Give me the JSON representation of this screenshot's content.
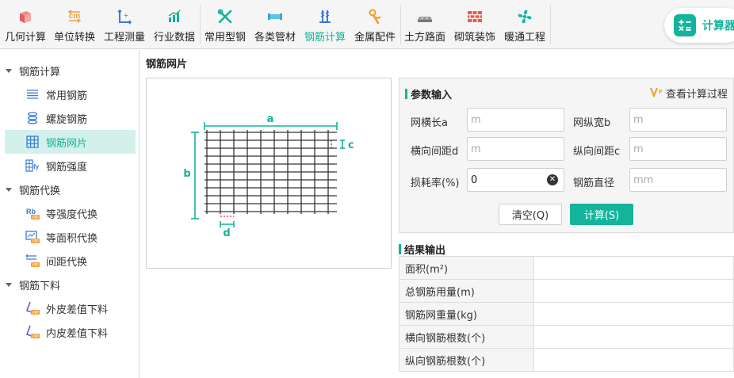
{
  "toolbar": {
    "items": [
      {
        "label": "几何计算",
        "icon": "cube-icon",
        "active": false
      },
      {
        "label": "单位转换",
        "icon": "unit-convert-icon",
        "active": false
      },
      {
        "label": "工程测量",
        "icon": "measure-axis-icon",
        "active": false
      },
      {
        "label": "行业数据",
        "icon": "bar-chart-icon",
        "active": false
      },
      {
        "label": "常用型钢",
        "icon": "wrench-icon",
        "active": false
      },
      {
        "label": "各类管材",
        "icon": "pipe-icon",
        "active": false
      },
      {
        "label": "钢筋计算",
        "icon": "rebar-icon",
        "active": true
      },
      {
        "label": "金属配件",
        "icon": "metal-fitting-icon",
        "active": false
      },
      {
        "label": "土方路面",
        "icon": "road-icon",
        "active": false
      },
      {
        "label": "砌筑装饰",
        "icon": "brick-wall-icon",
        "active": false
      },
      {
        "label": "暖通工程",
        "icon": "fan-icon",
        "active": false
      }
    ],
    "calculator_label": "计算器"
  },
  "sidebar": {
    "groups": [
      {
        "label": "钢筋计算",
        "items": [
          {
            "label": "常用钢筋",
            "icon": "lines-icon",
            "active": false
          },
          {
            "label": "螺旋钢筋",
            "icon": "spiral-icon",
            "active": false
          },
          {
            "label": "钢筋网片",
            "icon": "grid-icon",
            "active": true
          },
          {
            "label": "钢筋强度",
            "icon": "strength-fy-icon",
            "active": false
          }
        ]
      },
      {
        "label": "钢筋代换",
        "items": [
          {
            "label": "等强度代换",
            "icon": "rb-vip-icon",
            "active": false
          },
          {
            "label": "等面积代换",
            "icon": "area-vip-icon",
            "active": false
          },
          {
            "label": "间距代换",
            "icon": "spacing-vip-icon",
            "active": false
          }
        ]
      },
      {
        "label": "钢筋下料",
        "items": [
          {
            "label": "外皮差值下料",
            "icon": "outer-bend-vip-icon",
            "active": false
          },
          {
            "label": "内皮差值下料",
            "icon": "inner-bend-vip-icon",
            "active": false
          }
        ]
      }
    ]
  },
  "main": {
    "title": "钢筋网片",
    "diagram": {
      "label_a": "a",
      "label_b": "b",
      "label_c": "c",
      "label_d": "d"
    },
    "params": {
      "header": "参数输入",
      "view_process": "查看计算过程",
      "fields": [
        {
          "label": "网横长a",
          "value": "",
          "placeholder": "m"
        },
        {
          "label": "网纵宽b",
          "value": "",
          "placeholder": "m"
        },
        {
          "label": "横向间距d",
          "value": "",
          "placeholder": "m"
        },
        {
          "label": "纵向间距c",
          "value": "",
          "placeholder": "m"
        },
        {
          "label": "损耗率(%)",
          "value": "0",
          "placeholder": ""
        },
        {
          "label": "钢筋直径",
          "value": "",
          "placeholder": "mm"
        }
      ],
      "clear_button": "清空(Q)",
      "calc_button": "计算(S)"
    },
    "results": {
      "header": "结果输出",
      "rows": [
        {
          "label": "面积(m²)",
          "value": ""
        },
        {
          "label": "总钢筋用量(m)",
          "value": ""
        },
        {
          "label": "钢筋网重量(kg)",
          "value": ""
        },
        {
          "label": "横向钢筋根数(个)",
          "value": ""
        },
        {
          "label": "纵向钢筋根数(个)",
          "value": ""
        }
      ]
    }
  },
  "colors": {
    "accent": "#14b39b",
    "selected_bg": "#d4f0ea",
    "dim_red": "#c8282d"
  }
}
